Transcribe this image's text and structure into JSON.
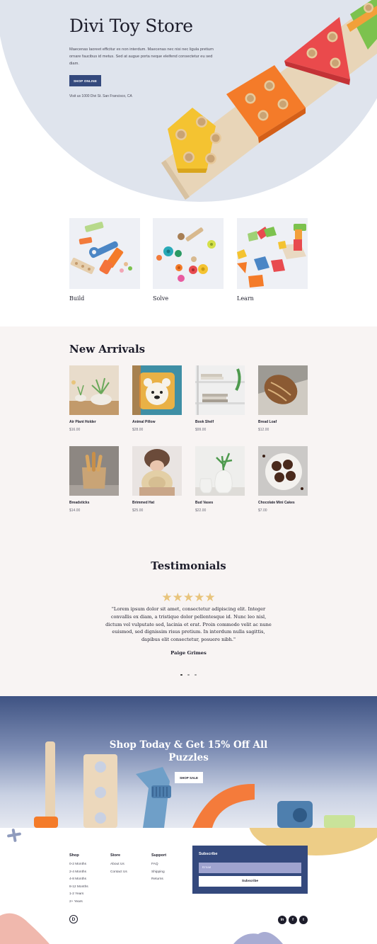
{
  "hero": {
    "title": "Divi Toy Store",
    "description": "Maecenas laoreet efficitur ex non interdum. Maecenas nec nisi nec ligula pretium ornare faucibus id metus. Sed at augue porta neque eleifend consectetur eu sed diam.",
    "button_label": "SHOP ONLINE",
    "visit_text": "Visit us 1000 Divi St. San Francisco, CA"
  },
  "categories": [
    {
      "label": "Build"
    },
    {
      "label": "Solve"
    },
    {
      "label": "Learn"
    }
  ],
  "new_arrivals": {
    "title": "New Arrivals",
    "products": [
      {
        "name": "Air Plant Holder",
        "price": "$16.00"
      },
      {
        "name": "Animal Pillow",
        "price": "$28.00"
      },
      {
        "name": "Book Shelf",
        "price": "$99.00"
      },
      {
        "name": "Bread Loaf",
        "price": "$12.00"
      },
      {
        "name": "Breadsticks",
        "price": "$14.00"
      },
      {
        "name": "Brimmed Hat",
        "price": "$25.00"
      },
      {
        "name": "Bud Vases",
        "price": "$22.00"
      },
      {
        "name": "Chocolate Mini Cakes",
        "price": "$7.00"
      }
    ]
  },
  "testimonials": {
    "title": "Testimonials",
    "stars": "★★★★★",
    "rating": 5,
    "quote": "\"Lorem ipsum dolor sit amet, consectetur adipiscing elit. Integer convallis ex diam, a tristique dolor pellentesque id. Nunc leo nisl, dictum vel vulputate sed, lacinia et erat. Proin commodo velit ac nune euismod, sed dignissim risus pretium. In interdum nulla sagittis, dapibus elit consectetur, posuere nibh.\"",
    "author": "Paige Grimes"
  },
  "promo": {
    "title": "Shop Today & Get 15% Off All Puzzles",
    "button_label": "SHOP SALE"
  },
  "footer": {
    "columns": [
      {
        "title": "Shop",
        "links": [
          "0-2 Months",
          "2-4 Months",
          "4-8 Months",
          "8-12 Months",
          "1-2 Years",
          "2+ Years"
        ]
      },
      {
        "title": "Store",
        "links": [
          "About Us",
          "Contact Us"
        ]
      },
      {
        "title": "Support",
        "links": [
          "FAQ",
          "Shipping",
          "Returns"
        ]
      }
    ],
    "subscribe": {
      "title": "Subscribe",
      "email_placeholder": "Email",
      "button_label": "Subscribe"
    },
    "logo_letter": "D",
    "social": [
      {
        "icon": "linkedin-icon",
        "glyph": "in"
      },
      {
        "icon": "facebook-icon",
        "glyph": "f"
      },
      {
        "icon": "twitter-icon",
        "glyph": "t"
      }
    ]
  },
  "colors": {
    "primary": "#34497d",
    "accent_gold": "#e8c47c",
    "hero_bg": "#dfe4ed",
    "section_bg": "#f8f4f3"
  }
}
